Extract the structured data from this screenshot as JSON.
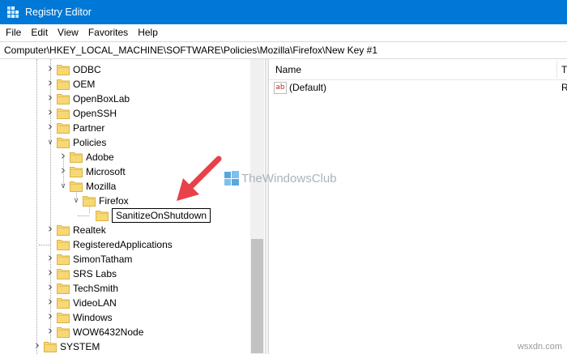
{
  "window": {
    "title": "Registry Editor"
  },
  "menu": [
    "File",
    "Edit",
    "View",
    "Favorites",
    "Help"
  ],
  "address": "Computer\\HKEY_LOCAL_MACHINE\\SOFTWARE\\Policies\\Mozilla\\Firefox\\New Key #1",
  "tree": [
    {
      "label": "ODBC",
      "level": 0,
      "chevron": "collapsed"
    },
    {
      "label": "OEM",
      "level": 0,
      "chevron": "collapsed"
    },
    {
      "label": "OpenBoxLab",
      "level": 0,
      "chevron": "collapsed"
    },
    {
      "label": "OpenSSH",
      "level": 0,
      "chevron": "collapsed"
    },
    {
      "label": "Partner",
      "level": 0,
      "chevron": "collapsed"
    },
    {
      "label": "Policies",
      "level": 0,
      "chevron": "expanded"
    },
    {
      "label": "Adobe",
      "level": 1,
      "chevron": "collapsed"
    },
    {
      "label": "Microsoft",
      "level": 1,
      "chevron": "collapsed"
    },
    {
      "label": "Mozilla",
      "level": 1,
      "chevron": "expanded"
    },
    {
      "label": "Firefox",
      "level": 2,
      "chevron": "expanded"
    },
    {
      "label": "SanitizeOnShutdown",
      "level": 3,
      "chevron": "none",
      "renaming": true
    },
    {
      "label": "Realtek",
      "level": 0,
      "chevron": "collapsed"
    },
    {
      "label": "RegisteredApplications",
      "level": 0,
      "chevron": "none"
    },
    {
      "label": "SimonTatham",
      "level": 0,
      "chevron": "collapsed"
    },
    {
      "label": "SRS Labs",
      "level": 0,
      "chevron": "collapsed"
    },
    {
      "label": "TechSmith",
      "level": 0,
      "chevron": "collapsed"
    },
    {
      "label": "VideoLAN",
      "level": 0,
      "chevron": "collapsed"
    },
    {
      "label": "Windows",
      "level": 0,
      "chevron": "collapsed"
    },
    {
      "label": "WOW6432Node",
      "level": 0,
      "chevron": "collapsed"
    },
    {
      "label": "SYSTEM",
      "level": -1,
      "chevron": "collapsed"
    }
  ],
  "columns": {
    "name": "Name",
    "type": "T"
  },
  "values": [
    {
      "name": "(Default)",
      "type": "R"
    }
  ],
  "watermark": "TheWindowsClub",
  "footer": "wsxdn.com",
  "colors": {
    "titlebar": "#0078d7",
    "arrow": "#e8414a",
    "folder": "#f8d775"
  },
  "icons": {
    "app": "registry-icon",
    "folder": "folder-icon",
    "value": "string-value-icon"
  }
}
